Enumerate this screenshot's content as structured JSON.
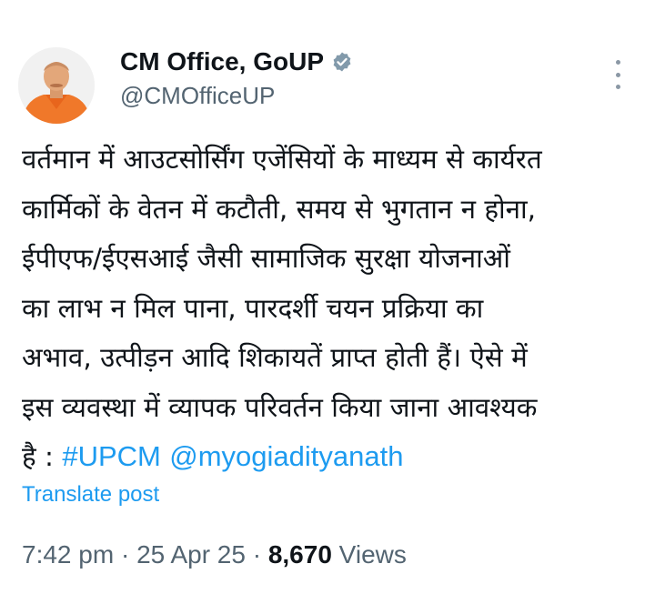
{
  "author": {
    "display_name": "CM Office, GoUP",
    "handle": "@CMOfficeUP",
    "verified_icon": "verified-badge-icon",
    "badge_color": "#829aab"
  },
  "tweet": {
    "lines": [
      "वर्तमान में आउटसोर्सिंग एजेंसियों के माध्यम से कार्यरत",
      "कार्मिकों के वेतन में कटौती, समय से भुगतान न होना,",
      "ईपीएफ/ईएसआई जैसी सामाजिक सुरक्षा योजनाओं",
      "का लाभ न मिल पाना, पारदर्शी चयन प्रक्रिया का",
      "अभाव, उत्पीड़न आदि शिकायतें प्राप्त होती हैं। ऐसे में",
      "इस व्यवस्था में व्यापक परिवर्तन किया जाना आवश्यक"
    ],
    "last_line_prefix": "है : ",
    "hashtag": "#UPCM",
    "mention": "@myogiadityanath"
  },
  "translate_label": "Translate post",
  "meta": {
    "time": "7:42 pm",
    "separator": " · ",
    "date": "25 Apr 25",
    "views_count": "8,670",
    "views_label": " Views"
  },
  "colors": {
    "link": "#1d9bf0",
    "secondary_text": "#536471",
    "primary_text": "#0f1419"
  },
  "icons": {
    "more": "more-options-icon"
  }
}
